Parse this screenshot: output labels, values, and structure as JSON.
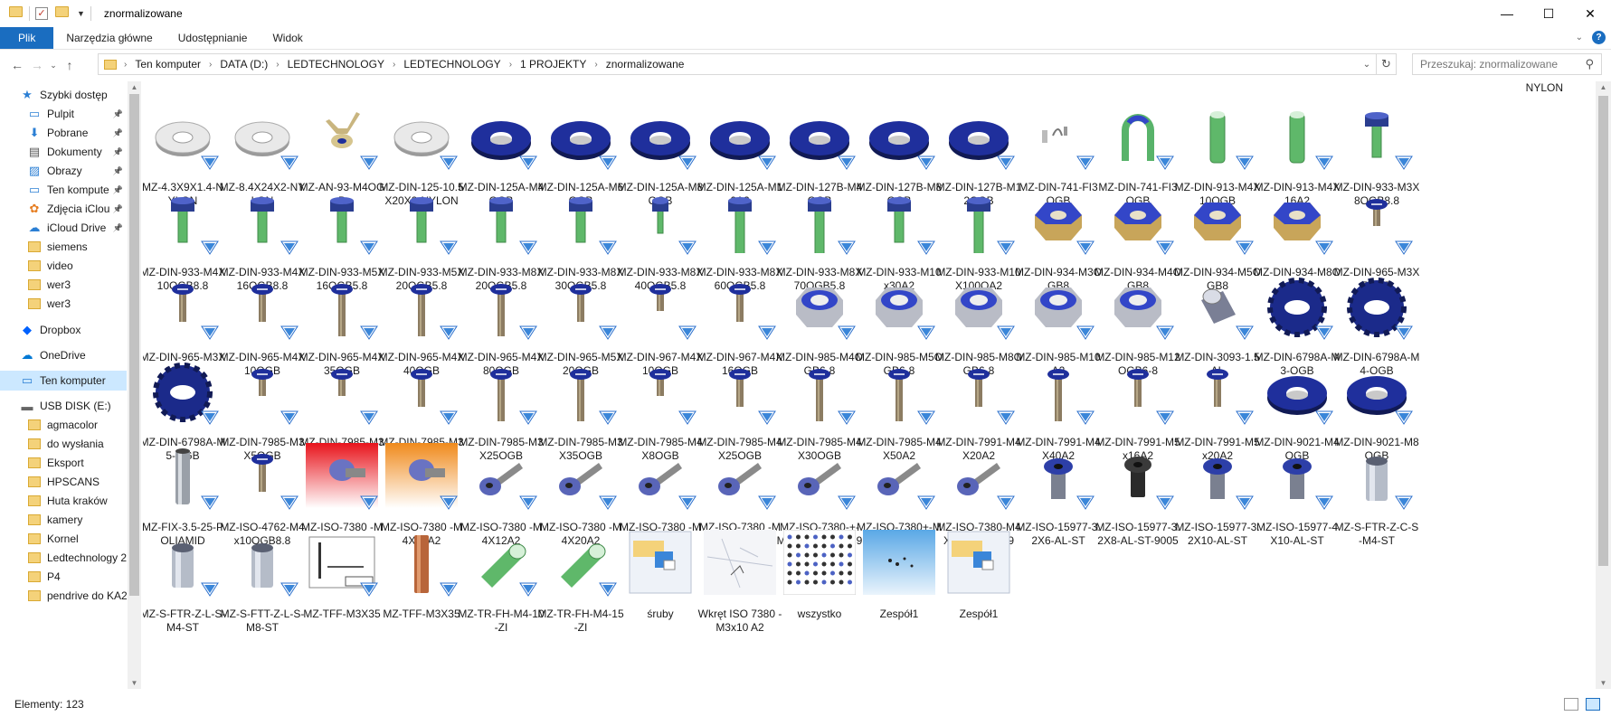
{
  "window": {
    "title": "znormalizowane",
    "minimize": "—",
    "maximize": "☐",
    "close": "✕"
  },
  "ribbon": {
    "tabs": [
      "Plik",
      "Narzędzia główne",
      "Udostępnianie",
      "Widok"
    ]
  },
  "address": {
    "crumbs": [
      "Ten komputer",
      "DATA (D:)",
      "LEDTECHNOLOGY",
      "LEDTECHNOLOGY",
      "1 PROJEKTY",
      "znormalizowane"
    ]
  },
  "search": {
    "placeholder": "Przeszukaj: znormalizowane"
  },
  "sidebar": {
    "items": [
      {
        "label": "Szybki dostęp",
        "icon": "star-icon",
        "pinned": false
      },
      {
        "label": "Pulpit",
        "icon": "desktop-icon",
        "pinned": true
      },
      {
        "label": "Pobrane",
        "icon": "download-icon",
        "pinned": true
      },
      {
        "label": "Dokumenty",
        "icon": "documents-icon",
        "pinned": true
      },
      {
        "label": "Obrazy",
        "icon": "pictures-icon",
        "pinned": true
      },
      {
        "label": "Ten kompute",
        "icon": "computer-icon",
        "pinned": true
      },
      {
        "label": "Zdjęcia iClou",
        "icon": "icloud-photos-icon",
        "pinned": true
      },
      {
        "label": "iCloud Drive",
        "icon": "icloud-drive-icon",
        "pinned": true
      },
      {
        "label": "siemens",
        "icon": "folder-icon",
        "pinned": false
      },
      {
        "label": "video",
        "icon": "folder-icon",
        "pinned": false
      },
      {
        "label": "wer3",
        "icon": "folder-icon",
        "pinned": false
      },
      {
        "label": "wer3",
        "icon": "folder-icon",
        "pinned": false
      },
      {
        "label": "Dropbox",
        "icon": "dropbox-icon",
        "pinned": false
      },
      {
        "label": "OneDrive",
        "icon": "onedrive-icon",
        "pinned": false
      },
      {
        "label": "Ten komputer",
        "icon": "computer-icon",
        "pinned": false
      },
      {
        "label": "USB DISK (E:)",
        "icon": "usb-drive-icon",
        "pinned": false
      },
      {
        "label": "agmacolor",
        "icon": "folder-icon",
        "pinned": false
      },
      {
        "label": "do wysłania",
        "icon": "folder-icon",
        "pinned": false
      },
      {
        "label": "Eksport",
        "icon": "folder-icon",
        "pinned": false
      },
      {
        "label": "HPSCANS",
        "icon": "folder-icon",
        "pinned": false
      },
      {
        "label": "Huta kraków",
        "icon": "folder-icon",
        "pinned": false
      },
      {
        "label": "kamery",
        "icon": "folder-icon",
        "pinned": false
      },
      {
        "label": "Kornel",
        "icon": "folder-icon",
        "pinned": false
      },
      {
        "label": "Ledtechnology 2",
        "icon": "folder-icon",
        "pinned": false
      },
      {
        "label": "P4",
        "icon": "folder-icon",
        "pinned": false
      },
      {
        "label": "pendrive do KA2",
        "icon": "folder-icon",
        "pinned": false
      }
    ],
    "selected": "Ten komputer"
  },
  "content": {
    "group_label": "NYLON",
    "files": [
      {
        "name": "MZ-4.3X9X1.4-NYLON",
        "kind": "washer-white"
      },
      {
        "name": "MZ-8.4X24X2-NYLON",
        "kind": "washer-white"
      },
      {
        "name": "MZ-AN-93-M4OGB",
        "kind": "wingnut"
      },
      {
        "name": "MZ-DIN-125-10.5X20X2-NYLON",
        "kind": "washer-white"
      },
      {
        "name": "MZ-DIN-125A-M4OGB",
        "kind": "washer-blue"
      },
      {
        "name": "MZ-DIN-125A-M6OGB",
        "kind": "washer-blue"
      },
      {
        "name": "MZ-DIN-125A-M8OGB",
        "kind": "washer-blue"
      },
      {
        "name": "MZ-DIN-125A-M10A2",
        "kind": "washer-blue"
      },
      {
        "name": "MZ-DIN-127B-M4OGB",
        "kind": "washer-blue"
      },
      {
        "name": "MZ-DIN-127B-M8OGB",
        "kind": "washer-blue"
      },
      {
        "name": "MZ-DIN-127B-M12OGB",
        "kind": "washer-blue"
      },
      {
        "name": "MZ-DIN-741-FI3OGB",
        "kind": "clip"
      },
      {
        "name": "MZ-DIN-741-FI3OGB",
        "kind": "ubolt"
      },
      {
        "name": "MZ-DIN-913-M4X10OGB",
        "kind": "grub-green"
      },
      {
        "name": "MZ-DIN-913-M4X16A2",
        "kind": "grub-green"
      },
      {
        "name": "MZ-DIN-933-M3X8OGB8.8",
        "kind": "hexbolt-green"
      },
      {
        "name": "MZ-DIN-933-M4X10OGB8.8",
        "kind": "hexbolt-green"
      },
      {
        "name": "MZ-DIN-933-M4X16OGB8.8",
        "kind": "hexbolt-green"
      },
      {
        "name": "MZ-DIN-933-M5X16OGB5.8",
        "kind": "hexbolt-green"
      },
      {
        "name": "MZ-DIN-933-M5X20OGB5.8",
        "kind": "hexbolt-green"
      },
      {
        "name": "MZ-DIN-933-M8X20OGB5.8",
        "kind": "hexbolt-green"
      },
      {
        "name": "MZ-DIN-933-M8X30OGB5.8",
        "kind": "hexbolt-green"
      },
      {
        "name": "MZ-DIN-933-M8X40OGB5.8",
        "kind": "hexbolt-green-small"
      },
      {
        "name": "MZ-DIN-933-M8X60OGB5.8",
        "kind": "hexbolt-green-long"
      },
      {
        "name": "MZ-DIN-933-M8X70OGB5.8",
        "kind": "hexbolt-green-long"
      },
      {
        "name": "MZ-DIN-933-M10x30A2",
        "kind": "hexbolt-green"
      },
      {
        "name": "MZ-DIN-933-M10X100OA2",
        "kind": "hexbolt-green-long"
      },
      {
        "name": "MZ-DIN-934-M3OGB8",
        "kind": "hexnut-blue"
      },
      {
        "name": "MZ-DIN-934-M4OGB8",
        "kind": "hexnut-blue"
      },
      {
        "name": "MZ-DIN-934-M5OGB8",
        "kind": "hexnut-blue"
      },
      {
        "name": "MZ-DIN-934-M8OGB8",
        "kind": "hexnut-blue"
      },
      {
        "name": "MZ-DIN-965-M3X5OGB",
        "kind": "screw-short"
      },
      {
        "name": "MZ-DIN-965-M3X10OGB",
        "kind": "screw"
      },
      {
        "name": "MZ-DIN-965-M4X10OGB",
        "kind": "screw"
      },
      {
        "name": "MZ-DIN-965-M4X35OGB",
        "kind": "screw-long"
      },
      {
        "name": "MZ-DIN-965-M4X40OGB",
        "kind": "screw-long"
      },
      {
        "name": "MZ-DIN-965-M4X80OGB",
        "kind": "screw-long"
      },
      {
        "name": "MZ-DIN-965-M5X20OGB",
        "kind": "screw"
      },
      {
        "name": "MZ-DIN-967-M4X10OGB",
        "kind": "screw-short"
      },
      {
        "name": "MZ-DIN-967-M4X16OGB",
        "kind": "screw"
      },
      {
        "name": "MZ-DIN-985-M4OGB6-8",
        "kind": "locknut"
      },
      {
        "name": "MZ-DIN-985-M5OGB6-8",
        "kind": "locknut"
      },
      {
        "name": "MZ-DIN-985-M8OGB6-8",
        "kind": "locknut"
      },
      {
        "name": "MZ-DIN-985-M10A2",
        "kind": "locknut"
      },
      {
        "name": "MZ-DIN-985-M12OGB6-8",
        "kind": "locknut"
      },
      {
        "name": "MZ-DIN-3093-1.5AL",
        "kind": "sleeve"
      },
      {
        "name": "MZ-DIN-6798A-M3-OGB",
        "kind": "tooth-washer"
      },
      {
        "name": "MZ-DIN-6798A-M4-OGB",
        "kind": "tooth-washer"
      },
      {
        "name": "MZ-DIN-6798A-M5-OGB",
        "kind": "tooth-washer"
      },
      {
        "name": "MZ-DIN-7985-M3X5OGB",
        "kind": "screw-short"
      },
      {
        "name": "MZ-DIN-7985-M3X8OGB",
        "kind": "screw-short"
      },
      {
        "name": "MZ-DIN-7985-M3X12OGB",
        "kind": "screw"
      },
      {
        "name": "MZ-DIN-7985-M3X25OGB",
        "kind": "screw-long"
      },
      {
        "name": "MZ-DIN-7985-M3X35OGB",
        "kind": "screw-long"
      },
      {
        "name": "MZ-DIN-7985-M4X8OGB",
        "kind": "screw-short"
      },
      {
        "name": "MZ-DIN-7985-M4X25OGB",
        "kind": "screw"
      },
      {
        "name": "MZ-DIN-7985-M4X30OGB",
        "kind": "screw-long"
      },
      {
        "name": "MZ-DIN-7985-M4X50A2",
        "kind": "screw-long"
      },
      {
        "name": "MZ-DIN-7991-M4X20A2",
        "kind": "screw"
      },
      {
        "name": "MZ-DIN-7991-M4X40A2",
        "kind": "screw-long"
      },
      {
        "name": "MZ-DIN-7991-M5x16A2",
        "kind": "screw"
      },
      {
        "name": "MZ-DIN-7991-M5x20A2",
        "kind": "screw"
      },
      {
        "name": "MZ-DIN-9021-M4OGB",
        "kind": "washer-blue-big"
      },
      {
        "name": "MZ-DIN-9021-M8OGB",
        "kind": "washer-blue-big"
      },
      {
        "name": "MZ-FIX-3.5-25-POLIAMID",
        "kind": "standoff-grey"
      },
      {
        "name": "MZ-ISO-4762-M4x10OGB8.8",
        "kind": "screw"
      },
      {
        "name": "MZ-ISO-7380 -M4X8A2",
        "kind": "button-red"
      },
      {
        "name": "MZ-ISO-7380 -M4X10A2",
        "kind": "button-orange"
      },
      {
        "name": "MZ-ISO-7380 -M4X12A2",
        "kind": "button-diag"
      },
      {
        "name": "MZ-ISO-7380 -M4X20A2",
        "kind": "button-diag"
      },
      {
        "name": "MZ-ISO-7380 -M4X25A2",
        "kind": "button-diag"
      },
      {
        "name": "MZ-ISO-7380 -M5X12A2",
        "kind": "button-diag"
      },
      {
        "name": "MZ-ISO-7380-+-M4X16OGB010.9",
        "kind": "button-diag"
      },
      {
        "name": "MZ-ISO-7380+-M5X12A2",
        "kind": "button-diag"
      },
      {
        "name": "MZ-ISO-7380-M4X16OGB010.9",
        "kind": "button-diag"
      },
      {
        "name": "MZ-ISO-15977-3.2X6-AL-ST",
        "kind": "rivet-blue"
      },
      {
        "name": "MZ-ISO-15977-3.2X8-AL-ST-9005",
        "kind": "rivet-black"
      },
      {
        "name": "MZ-ISO-15977-3.2X10-AL-ST",
        "kind": "rivet-blue"
      },
      {
        "name": "MZ-ISO-15977-4X10-AL-ST",
        "kind": "rivet-blue"
      },
      {
        "name": "MZ-S-FTR-Z-C-S-M4-ST",
        "kind": "insert-grey"
      },
      {
        "name": "MZ-S-FTR-Z-L-S-M4-ST",
        "kind": "insert-grey"
      },
      {
        "name": "MZ-S-FTT-Z-L-S-M8-ST",
        "kind": "insert-grey"
      },
      {
        "name": "MZ-TFF-M3X35",
        "kind": "drawing"
      },
      {
        "name": "MZ-TFF-M3X35",
        "kind": "standoff-copper"
      },
      {
        "name": "MZ-TR-FH-M4-10-ZI",
        "kind": "tube-green"
      },
      {
        "name": "MZ-TR-FH-M4-15-ZI",
        "kind": "tube-green"
      },
      {
        "name": "śruby",
        "kind": "assembly-doc"
      },
      {
        "name": "Wkręt ISO 7380 - M3x10 A2",
        "kind": "sketch"
      },
      {
        "name": "wszystko",
        "kind": "grid-sheet"
      },
      {
        "name": "Zespół1",
        "kind": "blue-scene"
      },
      {
        "name": "Zespół1",
        "kind": "assembly-doc"
      }
    ]
  },
  "status": {
    "count": "Elementy: 123"
  }
}
